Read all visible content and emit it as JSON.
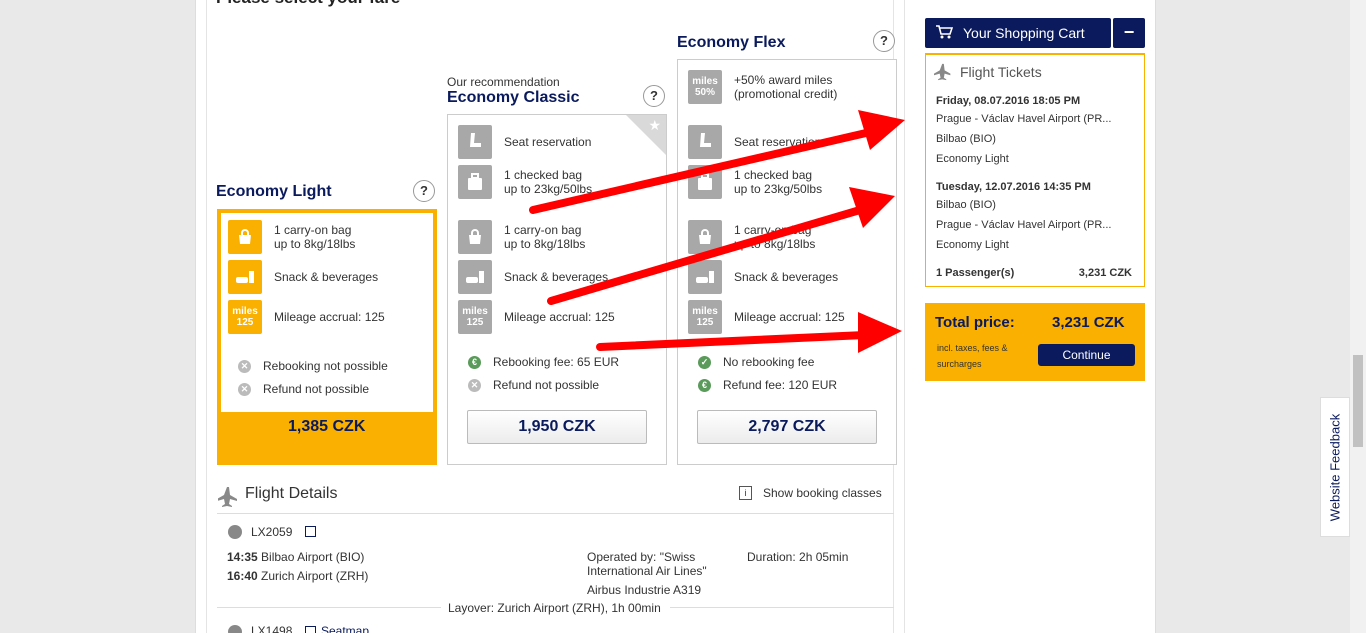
{
  "section_title": "Please select your fare",
  "fares": [
    {
      "name": "Economy Light",
      "features": [
        "1 carry-on bag\nup to 8kg/18lbs",
        "Snack & beverages",
        "Mileage accrual: 125"
      ],
      "miles_badge": "miles\n125",
      "conditions": [
        "Rebooking not possible",
        "Refund not possible"
      ],
      "price": "1,385 CZK"
    },
    {
      "name": "Economy Classic",
      "recommendation": "Our recommendation",
      "features": [
        "Seat reservation",
        "1 checked bag\nup to 23kg/50lbs",
        "1 carry-on bag\nup to 8kg/18lbs",
        "Snack & beverages",
        "Mileage accrual: 125"
      ],
      "miles_badge": "miles\n125",
      "conditions": [
        "Rebooking fee: 65 EUR",
        "Refund not possible"
      ],
      "price": "1,950 CZK"
    },
    {
      "name": "Economy Flex",
      "award": "+50% award miles\n(promotional credit)",
      "award_badge": "miles\n50%",
      "features": [
        "Seat reservation",
        "1 checked bag\nup to 23kg/50lbs",
        "1 carry-on bag\nup to 8kg/18lbs",
        "Snack & beverages",
        "Mileage accrual: 125"
      ],
      "miles_badge": "miles\n125",
      "conditions": [
        "No rebooking fee",
        "Refund fee: 120 EUR"
      ],
      "price": "2,797 CZK"
    }
  ],
  "help_label": "?",
  "flight_details": {
    "title": "Flight Details",
    "show_booking_classes": "Show booking classes",
    "seatmap": "Seatmap",
    "segments": [
      {
        "flight": "LX2059",
        "dep_time": "14:35",
        "dep_airport": "Bilbao Airport (BIO)",
        "arr_time": "16:40",
        "arr_airport": "Zurich Airport (ZRH)",
        "operated_by": "Operated by: \"Swiss\nInternational Air Lines\"",
        "aircraft": "Airbus Industrie A319",
        "duration": "Duration: 2h 05min"
      },
      {
        "flight": "LX1498"
      }
    ],
    "layover": "Layover: Zurich Airport (ZRH), 1h 00min"
  },
  "cart": {
    "title": "Your Shopping Cart",
    "collapse": "−",
    "section": "Flight Tickets",
    "outbound": {
      "date": "Friday, 08.07.2016 18:05 PM",
      "from": "Prague - Václav Havel Airport (PR...",
      "to": "Bilbao (BIO)",
      "fare": "Economy Light"
    },
    "inbound": {
      "date": "Tuesday, 12.07.2016 14:35 PM",
      "from": "Bilbao (BIO)",
      "to": "Prague - Václav Havel Airport (PR...",
      "fare": "Economy Light"
    },
    "passengers": "1 Passenger(s)",
    "passengers_price": "3,231 CZK",
    "total_label": "Total price:",
    "total_value": "3,231 CZK",
    "total_note": "incl. taxes, fees &\nsurcharges",
    "continue": "Continue"
  },
  "feedback": "Website Feedback",
  "colors": {
    "brand_navy": "#0a1a5c",
    "accent_gold": "#f9b000",
    "annotation_red": "#ff0000"
  }
}
